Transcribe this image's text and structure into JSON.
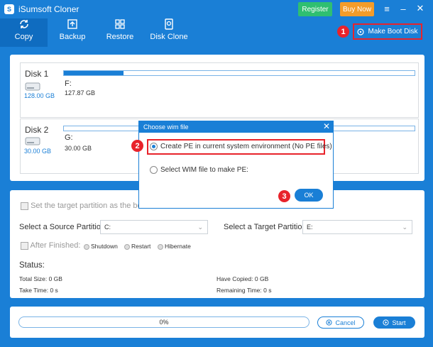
{
  "app": {
    "title": "iSumsoft Cloner",
    "register_label": "Register",
    "buy_label": "Buy Now"
  },
  "nav": {
    "tabs": [
      {
        "label": "Copy",
        "icon": "copy-icon",
        "active": true
      },
      {
        "label": "Backup",
        "icon": "backup-icon"
      },
      {
        "label": "Restore",
        "icon": "restore-icon"
      },
      {
        "label": "Disk Clone",
        "icon": "disk-clone-icon"
      }
    ],
    "make_boot_label": "Make Boot Disk"
  },
  "markers": [
    "1",
    "2",
    "3"
  ],
  "disks": [
    {
      "name": "Disk 1",
      "size": "128.00 GB",
      "partition": "F:",
      "capacity": "127.87 GB",
      "usage": 0.17
    },
    {
      "name": "Disk 2",
      "size": "30.00 GB",
      "partition": "G:",
      "capacity": "30.00 GB",
      "usage": 0.0
    }
  ],
  "options": {
    "set_boot_label": "Set the target partition as the boot d",
    "source_label": "Select a Source Partition:",
    "source_value": "C:",
    "target_label": "Select a Target Partition:",
    "target_value": "E:",
    "after_finished_label": "After Finished:",
    "after_choices": [
      "Shutdown",
      "Restart",
      "Hibernate"
    ]
  },
  "status": {
    "heading": "Status:",
    "total_size": "Total Size: 0 GB",
    "take_time": "Take Time: 0 s",
    "have_copied": "Have Copied: 0 GB",
    "remaining_time": "Remaining Time: 0 s"
  },
  "progress": {
    "percent": 0,
    "text": "0%"
  },
  "actions": {
    "cancel_label": "Cancel",
    "start_label": "Start"
  },
  "dialog": {
    "title": "Choose wim file",
    "option1": "Create PE in current system environment (No PE files)",
    "option2": "Select WIM file to make PE:",
    "ok_label": "OK"
  },
  "colors": {
    "accent": "#1a7fd6",
    "highlight": "#e8232b",
    "register": "#2fbf71",
    "buy": "#f39c2a"
  }
}
